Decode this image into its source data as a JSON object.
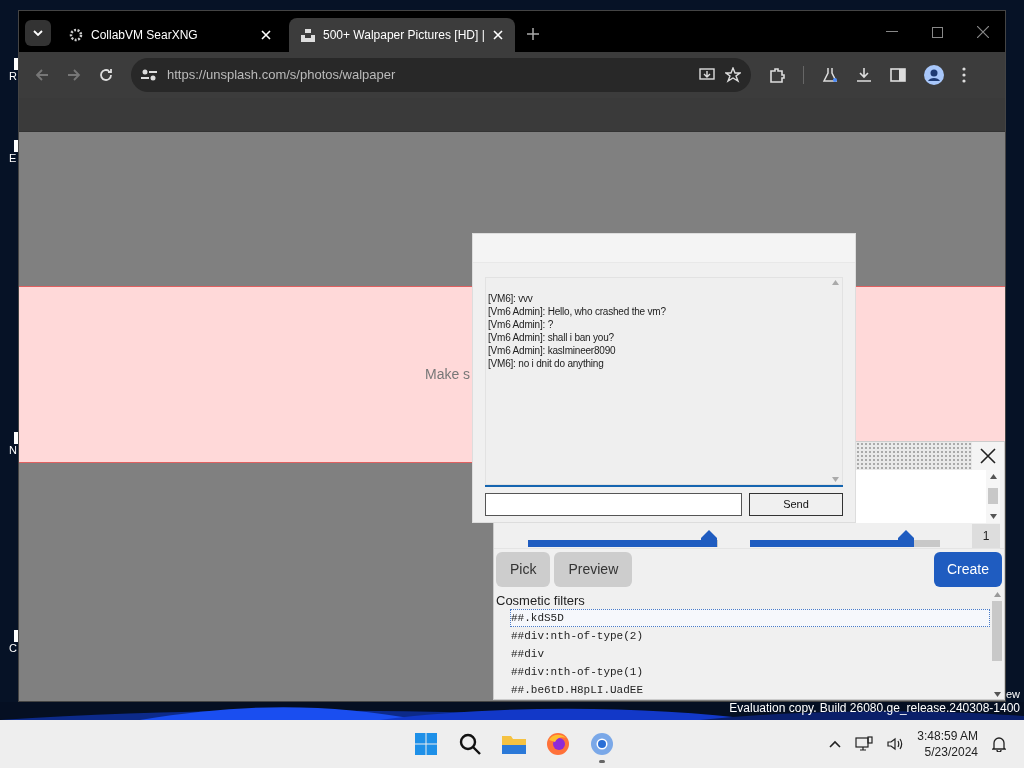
{
  "desktop": {
    "icon_labels": [
      "R",
      "E",
      "N",
      "C"
    ],
    "edge_text": "ew",
    "watermark": "Evaluation copy. Build 26080.ge_release.240308-1400"
  },
  "browser": {
    "tabs": [
      {
        "title": "CollabVM SearXNG",
        "selected": false
      },
      {
        "title": "500+ Walpaper Pictures [HD] |",
        "selected": true
      }
    ],
    "url": "https://unsplash.com/s/photos/walpaper",
    "banner_text": "Make s"
  },
  "chat": {
    "messages": [
      "[VM6]: vvv",
      "[Vm6 Admin]: Hello, who crashed the vm?",
      "[Vm6 Admin]: ?",
      "[Vm6 Admin]: shall i ban you?",
      "[Vm6 Admin]: kaslmineer8090",
      "[VM6]: no i dnit do anything"
    ],
    "send_label": "Send"
  },
  "filter_panel": {
    "sliders": [
      {
        "level": 0.95
      },
      {
        "level": 0.82
      }
    ],
    "count": "1",
    "buttons": [
      {
        "label": "Pick",
        "kind": "secondary"
      },
      {
        "label": "Preview",
        "kind": "secondary"
      },
      {
        "label": "Create",
        "kind": "primary"
      }
    ],
    "list_title": "Cosmetic filters",
    "filters": [
      {
        "text": "##.kdS5D",
        "selected": true
      },
      {
        "text": "##div:nth-of-type(2)",
        "selected": false
      },
      {
        "text": "##div",
        "selected": false
      },
      {
        "text": "##div:nth-of-type(1)",
        "selected": false
      },
      {
        "text": "##.be6tD.H8pLI.UadEE",
        "selected": false
      }
    ]
  },
  "taskbar": {
    "apps": [
      {
        "kind": "start",
        "running": false
      },
      {
        "kind": "search",
        "running": false
      },
      {
        "kind": "files",
        "running": false
      },
      {
        "kind": "firefox",
        "running": false
      },
      {
        "kind": "chrome",
        "running": true
      }
    ],
    "time": "3:48:59 AM",
    "date": "5/23/2024"
  }
}
